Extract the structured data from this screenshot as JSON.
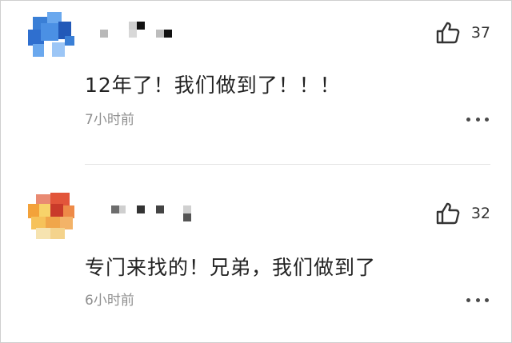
{
  "comments": [
    {
      "like_count": "37",
      "text": "12年了！我们做到了！！！",
      "time": "7小时前",
      "like_icon": "thumbs-up-icon",
      "more_icon": "more-dots-icon"
    },
    {
      "like_count": "32",
      "text": "专门来找的！兄弟，我们做到了",
      "time": "6小时前",
      "like_icon": "thumbs-up-icon",
      "more_icon": "more-dots-icon"
    }
  ],
  "colors": {
    "avatar1": [
      "#3a7fd6",
      "#6aa8ee",
      "#2259b8",
      "#9cc6f6"
    ],
    "avatar2": [
      "#e2553a",
      "#f3a23a",
      "#f7d36a",
      "#c93a2a",
      "#f6e3b0"
    ],
    "text": "#222222",
    "meta": "#8f8f8f"
  }
}
